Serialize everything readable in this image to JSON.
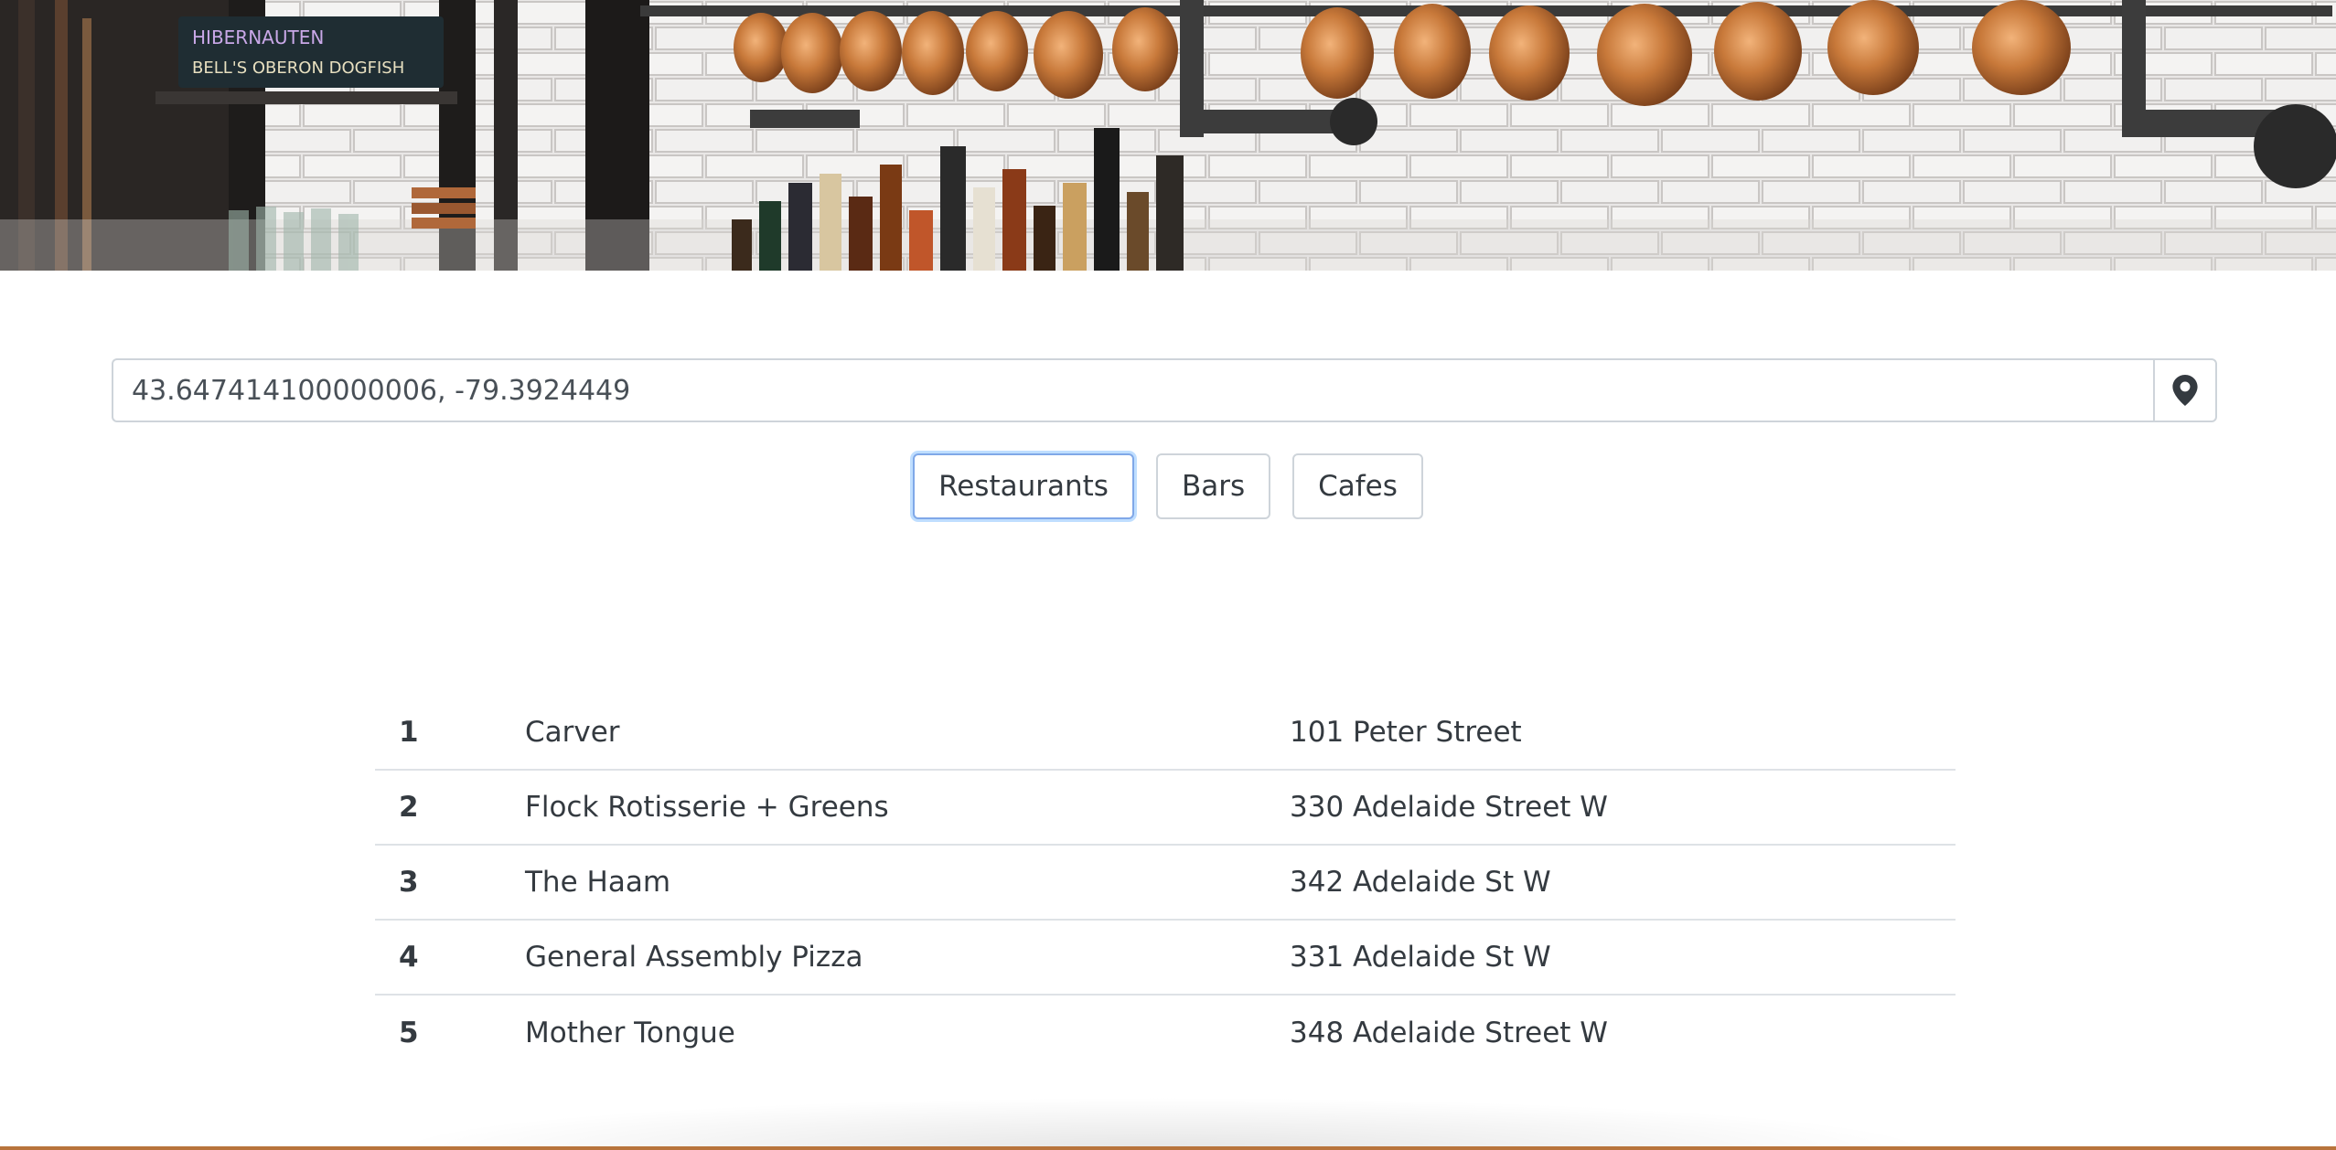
{
  "search": {
    "value": "43.647414100000006, -79.3924449"
  },
  "filters": [
    {
      "label": "Restaurants",
      "active": true
    },
    {
      "label": "Bars",
      "active": false
    },
    {
      "label": "Cafes",
      "active": false
    }
  ],
  "results": [
    {
      "rank": "1",
      "name": "Carver",
      "address": "101 Peter Street"
    },
    {
      "rank": "2",
      "name": "Flock Rotisserie + Greens",
      "address": "330 Adelaide Street W"
    },
    {
      "rank": "3",
      "name": "The Haam",
      "address": "342 Adelaide St W"
    },
    {
      "rank": "4",
      "name": "General Assembly Pizza",
      "address": "331 Adelaide St W"
    },
    {
      "rank": "5",
      "name": "Mother Tongue",
      "address": "348 Adelaide Street W"
    }
  ],
  "icons": {
    "locate": "map-marker-icon"
  },
  "colors": {
    "active_border": "#80a8e8",
    "copper": "#c8793a"
  }
}
